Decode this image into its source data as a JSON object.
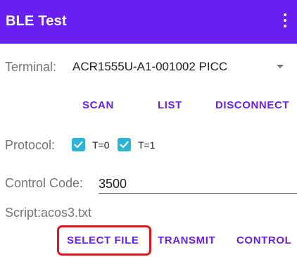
{
  "appbar": {
    "title": "BLE Test",
    "menu_icon": "more-vert-icon",
    "color": "#6a1ff2"
  },
  "terminal": {
    "label": "Terminal:",
    "value": "ACR1555U-A1-001002 PICC"
  },
  "buttons": {
    "scan": "SCAN",
    "list": "LIST",
    "disconnect": "DISCONNECT",
    "select_file": "SELECT FILE",
    "transmit": "TRANSMIT",
    "control": "CONTROL"
  },
  "protocol": {
    "label": "Protocol:",
    "options": [
      {
        "label": "T=0",
        "checked": true
      },
      {
        "label": "T=1",
        "checked": true
      }
    ],
    "checkbox_color": "#2ab5d8"
  },
  "control_code": {
    "label": "Control Code:",
    "value": "3500"
  },
  "script": {
    "label": "Script:acos3.txt"
  },
  "highlight_color": "#e4141c"
}
